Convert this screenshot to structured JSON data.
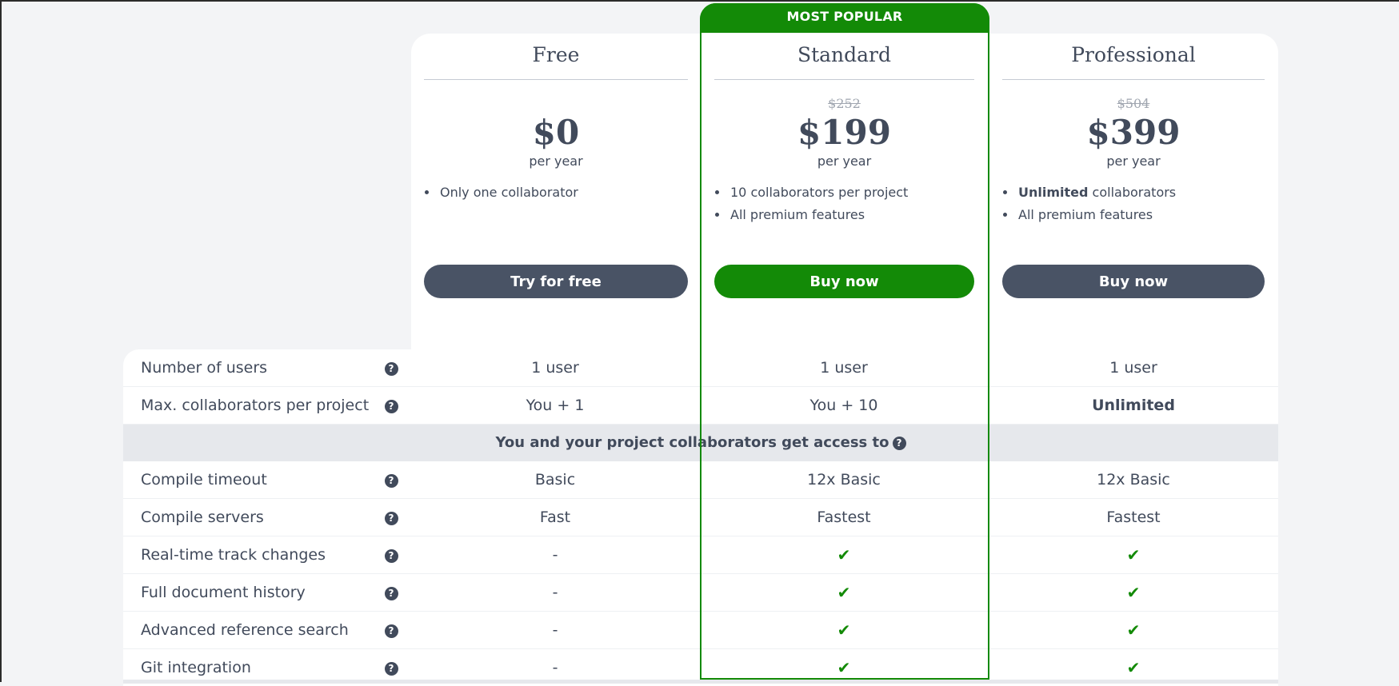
{
  "badge": "MOST POPULAR",
  "plans": [
    {
      "name": "Free",
      "old_price": "",
      "price": "$0",
      "period": "per year",
      "bullets": [
        "Only one collaborator"
      ],
      "cta": "Try for free"
    },
    {
      "name": "Standard",
      "old_price": "$252",
      "price": "$199",
      "period": "per year",
      "bullets": [
        "10 collaborators per project",
        "All premium features"
      ],
      "cta": "Buy now"
    },
    {
      "name": "Professional",
      "old_price": "$504",
      "price": "$399",
      "period": "per year",
      "bullets_bold": "Unlimited",
      "bullets_rest": " collaborators",
      "bullet2": "All premium features",
      "cta": "Buy now"
    }
  ],
  "help_icon": "question-circle-icon",
  "check_icon": "check-icon",
  "rows_top": [
    {
      "label": "Number of users",
      "values": [
        "1 user",
        "1 user",
        "1 user"
      ]
    },
    {
      "label": "Max. collaborators per project",
      "values": [
        "You + 1",
        "You + 10",
        "Unlimited"
      ]
    }
  ],
  "section_title": "You and your project collaborators get access to",
  "rows_features": [
    {
      "label": "Compile timeout",
      "values": [
        "Basic",
        "12x Basic",
        "12x Basic"
      ]
    },
    {
      "label": "Compile servers",
      "values": [
        "Fast",
        "Fastest",
        "Fastest"
      ]
    },
    {
      "label": "Real-time track changes",
      "values": [
        "-",
        "✔",
        "✔"
      ]
    },
    {
      "label": "Full document history",
      "values": [
        "-",
        "✔",
        "✔"
      ]
    },
    {
      "label": "Advanced reference search",
      "values": [
        "-",
        "✔",
        "✔"
      ]
    },
    {
      "label": "Git integration",
      "values": [
        "-",
        "✔",
        "✔"
      ]
    }
  ],
  "colors": {
    "accent": "#138a07",
    "dark_button": "#495365",
    "text": "#414a5b"
  }
}
